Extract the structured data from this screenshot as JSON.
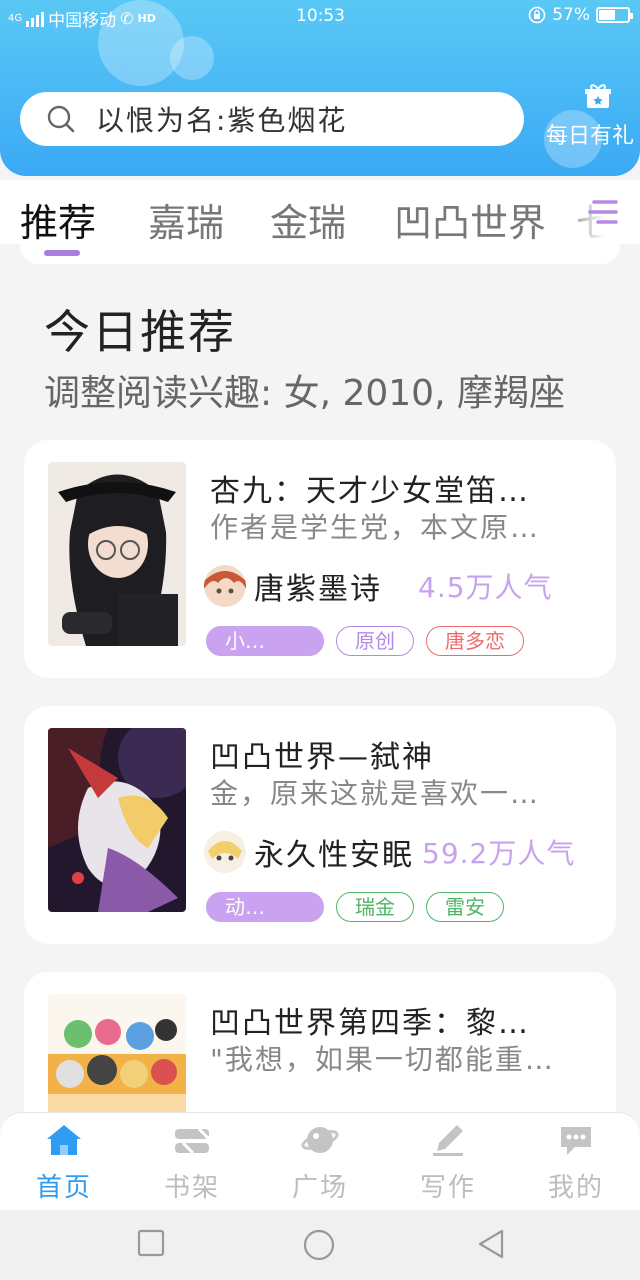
{
  "status_bar": {
    "network": "4G",
    "carrier": "中国移动",
    "hd": "HD",
    "time": "10:53",
    "battery": "57%",
    "battery_level": 0.57
  },
  "search": {
    "query": "以恨为名:紫色烟花"
  },
  "daily_gift": {
    "label": "每日有礼"
  },
  "tabs": [
    {
      "label": "推荐",
      "active": true
    },
    {
      "label": "嘉瑞",
      "active": false
    },
    {
      "label": "金瑞",
      "active": false
    },
    {
      "label": "凹凸世界",
      "active": false
    },
    {
      "label": "七",
      "active": false
    }
  ],
  "today": {
    "title": "今日推荐",
    "subtitle": "调整阅读兴趣: 女, 2010, 摩羯座"
  },
  "books": [
    {
      "title": "杏九：天才少女堂笛…",
      "desc": "作者是学生党，本文原…",
      "author": "唐紫墨诗",
      "popularity": "4.5万人气",
      "tags": [
        {
          "label": "小…",
          "style": "fill"
        },
        {
          "label": "原创",
          "style": "purple"
        },
        {
          "label": "唐多恋",
          "style": "red"
        }
      ],
      "cover_colors": [
        "#1e1e22",
        "#efeae4"
      ]
    },
    {
      "title": "凹凸世界—弑神",
      "desc": "金，原来这就是喜欢一…",
      "author": "永久性安眠",
      "popularity": "59.2万人气",
      "tags": [
        {
          "label": "动…",
          "style": "fill"
        },
        {
          "label": "瑞金",
          "style": "green"
        },
        {
          "label": "雷安",
          "style": "green"
        }
      ],
      "cover_colors": [
        "#23172e",
        "#c43a3a"
      ]
    },
    {
      "title": "凹凸世界第四季：黎…",
      "desc": "\"我想，如果一切都能重…",
      "author": "",
      "popularity": "",
      "tags": [],
      "cover_colors": [
        "#f3b248",
        "#6bbf6e"
      ]
    }
  ],
  "bottom_nav": [
    {
      "label": "首页",
      "icon": "home-icon",
      "active": true
    },
    {
      "label": "书架",
      "icon": "bookshelf-icon",
      "active": false
    },
    {
      "label": "广场",
      "icon": "planet-icon",
      "active": false
    },
    {
      "label": "写作",
      "icon": "pen-icon",
      "active": false
    },
    {
      "label": "我的",
      "icon": "chat-icon",
      "active": false
    }
  ],
  "colors": {
    "header_top": "#5ac8f5",
    "header_bottom": "#3aa9f5",
    "accent_purple": "#c9a3ef",
    "nav_active": "#2f9cf3"
  }
}
